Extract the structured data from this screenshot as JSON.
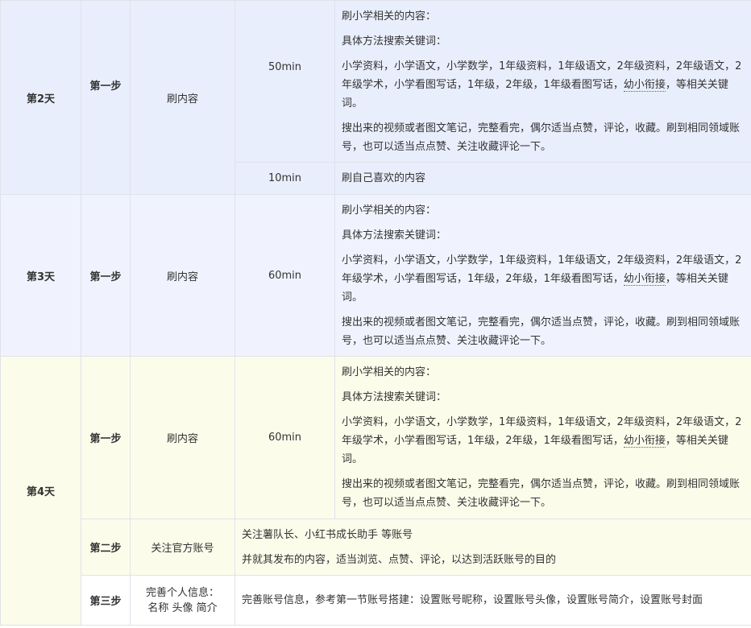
{
  "day2": {
    "label": "第2天",
    "step": "第一步",
    "action": "刷内容",
    "dur1": "50min",
    "p1": "刷小学相关的内容：",
    "p2": "具体方法搜索关键词：",
    "p3a": "小学资料，小学语文，小学数学，1年级资料，1年级语文，2年级资料，2年级语文，2年级学术，小学看图写话，1年级，2年级，1年级看图写话，",
    "p3b": "幼小衔接",
    "p3c": "，等相关关键词。",
    "p4": "搜出来的视频或者图文笔记，完整看完，偶尔适当点赞，评论，收藏。刷到相同领域账号，也可以适当点点赞、关注收藏评论一下。",
    "dur2": "10min",
    "p5": "刷自己喜欢的内容"
  },
  "day3": {
    "label": "第3天",
    "step": "第一步",
    "action": "刷内容",
    "dur": "60min",
    "p1": "刷小学相关的内容：",
    "p2": "具体方法搜索关键词：",
    "p3a": "小学资料，小学语文，小学数学，1年级资料，1年级语文，2年级资料，2年级语文，2年级学术，小学看图写话，1年级，2年级，1年级看图写话，",
    "p3b": "幼小衔接",
    "p3c": "，等相关关键词。",
    "p4": "搜出来的视频或者图文笔记，完整看完，偶尔适当点赞，评论，收藏。刷到相同领域账号，也可以适当点点赞、关注收藏评论一下。"
  },
  "day4": {
    "label": "第4天",
    "step1": "第一步",
    "action1": "刷内容",
    "dur": "60min",
    "p1": "刷小学相关的内容：",
    "p2": "具体方法搜索关键词：",
    "p3a": "小学资料，小学语文，小学数学，1年级资料，1年级语文，2年级资料，2年级语文，2年级学术，小学看图写话，1年级，2年级，1年级看图写话，",
    "p3b": "幼小衔接",
    "p3c": "，等相关关键词。",
    "p4": "搜出来的视频或者图文笔记，完整看完，偶尔适当点赞，评论，收藏。刷到相同领域账号，也可以适当点点赞、关注收藏评论一下。",
    "step2": "第二步",
    "action2": "关注官方账号",
    "s2p1": "关注薯队长、小红书成长助手 等账号",
    "s2p2": "并就其发布的内容，适当浏览、点赞、评论，以达到活跃账号的目的",
    "step3": "第三步",
    "action3a": "完善个人信息：",
    "action3b": "名称 头像 简介",
    "s3p1": "完善账号信息，参考第一节账号搭建：设置账号昵称，设置账号头像，设置账号简介，设置账号封面"
  }
}
